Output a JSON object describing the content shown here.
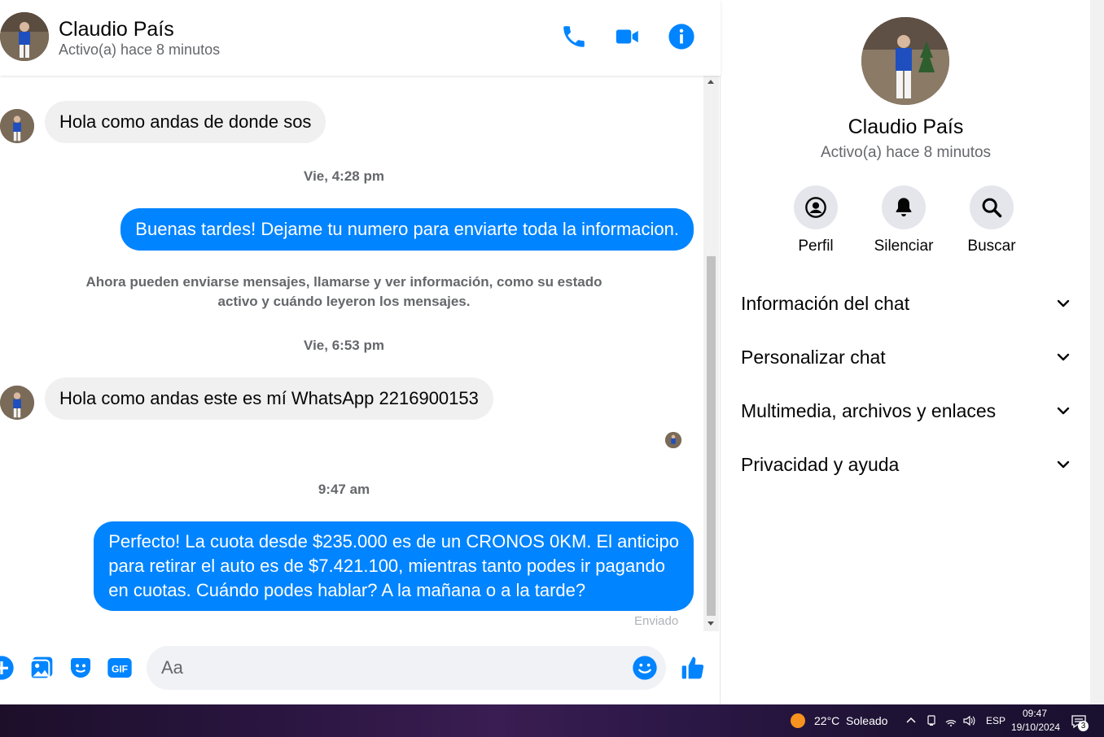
{
  "contact": {
    "name": "Claudio País",
    "status": "Activo(a) hace 8 minutos"
  },
  "messages": {
    "in_1": "Hola como andas de donde sos",
    "time_1": "Vie, 4:28 pm",
    "out_1": "Buenas tardes! Dejame tu numero para enviarte toda la informacion.",
    "system_note_line1": "Ahora pueden enviarse mensajes, llamarse y ver información, como su estado",
    "system_note_line2": "activo y cuándo leyeron los mensajes.",
    "time_2": "Vie, 6:53 pm",
    "in_2": "Hola como andas este es mí WhatsApp 2216900153",
    "time_3": "9:47 am",
    "out_2_line1": "Perfecto! La cuota desde $235.000 es de un CRONOS 0KM. El anticipo",
    "out_2_line2": "para retirar el auto es de $7.421.100, mientras tanto podes ir pagando",
    "out_2_line3": "en cuotas. Cuándo podes hablar? A la mañana o a la tarde?",
    "sent_label": "Enviado"
  },
  "composer": {
    "placeholder": "Aa"
  },
  "side_panel": {
    "actions": [
      {
        "label": "Perfil",
        "icon": "profile-icon"
      },
      {
        "label": "Silenciar",
        "icon": "bell-icon"
      },
      {
        "label": "Buscar",
        "icon": "search-icon"
      }
    ],
    "sections": [
      {
        "label": "Información del chat"
      },
      {
        "label": "Personalizar chat"
      },
      {
        "label": "Multimedia, archivos y enlaces"
      },
      {
        "label": "Privacidad y ayuda"
      }
    ]
  },
  "taskbar": {
    "weather": "22°C  Soleado",
    "lang": "ESP",
    "time": "09:47",
    "date": "19/10/2024",
    "notif_count": "3"
  },
  "colors": {
    "accent": "#0084ff",
    "bubble_in": "#f0f0f0"
  }
}
